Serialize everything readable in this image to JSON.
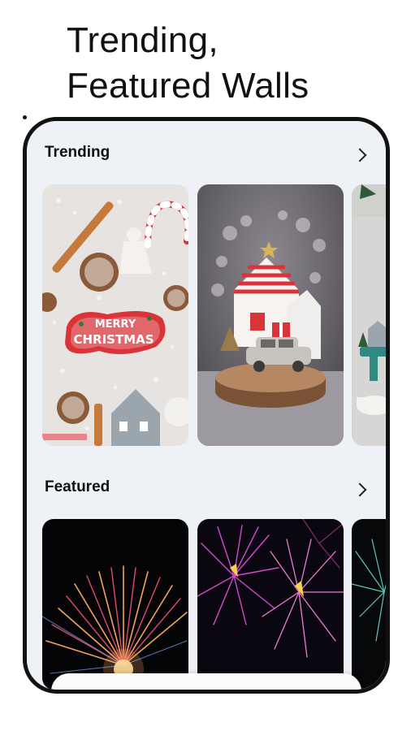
{
  "headline": {
    "line1": "Trending,",
    "line2": "Featured Walls"
  },
  "trending": {
    "title": "Trending"
  },
  "featured": {
    "title": "Featured"
  },
  "card_text": {
    "merry": "MERRY",
    "christmas": "CHRISTMAS"
  },
  "colors": {
    "frame": "#111111",
    "background": "#eef1f6",
    "accent_red": "#d9343a"
  }
}
